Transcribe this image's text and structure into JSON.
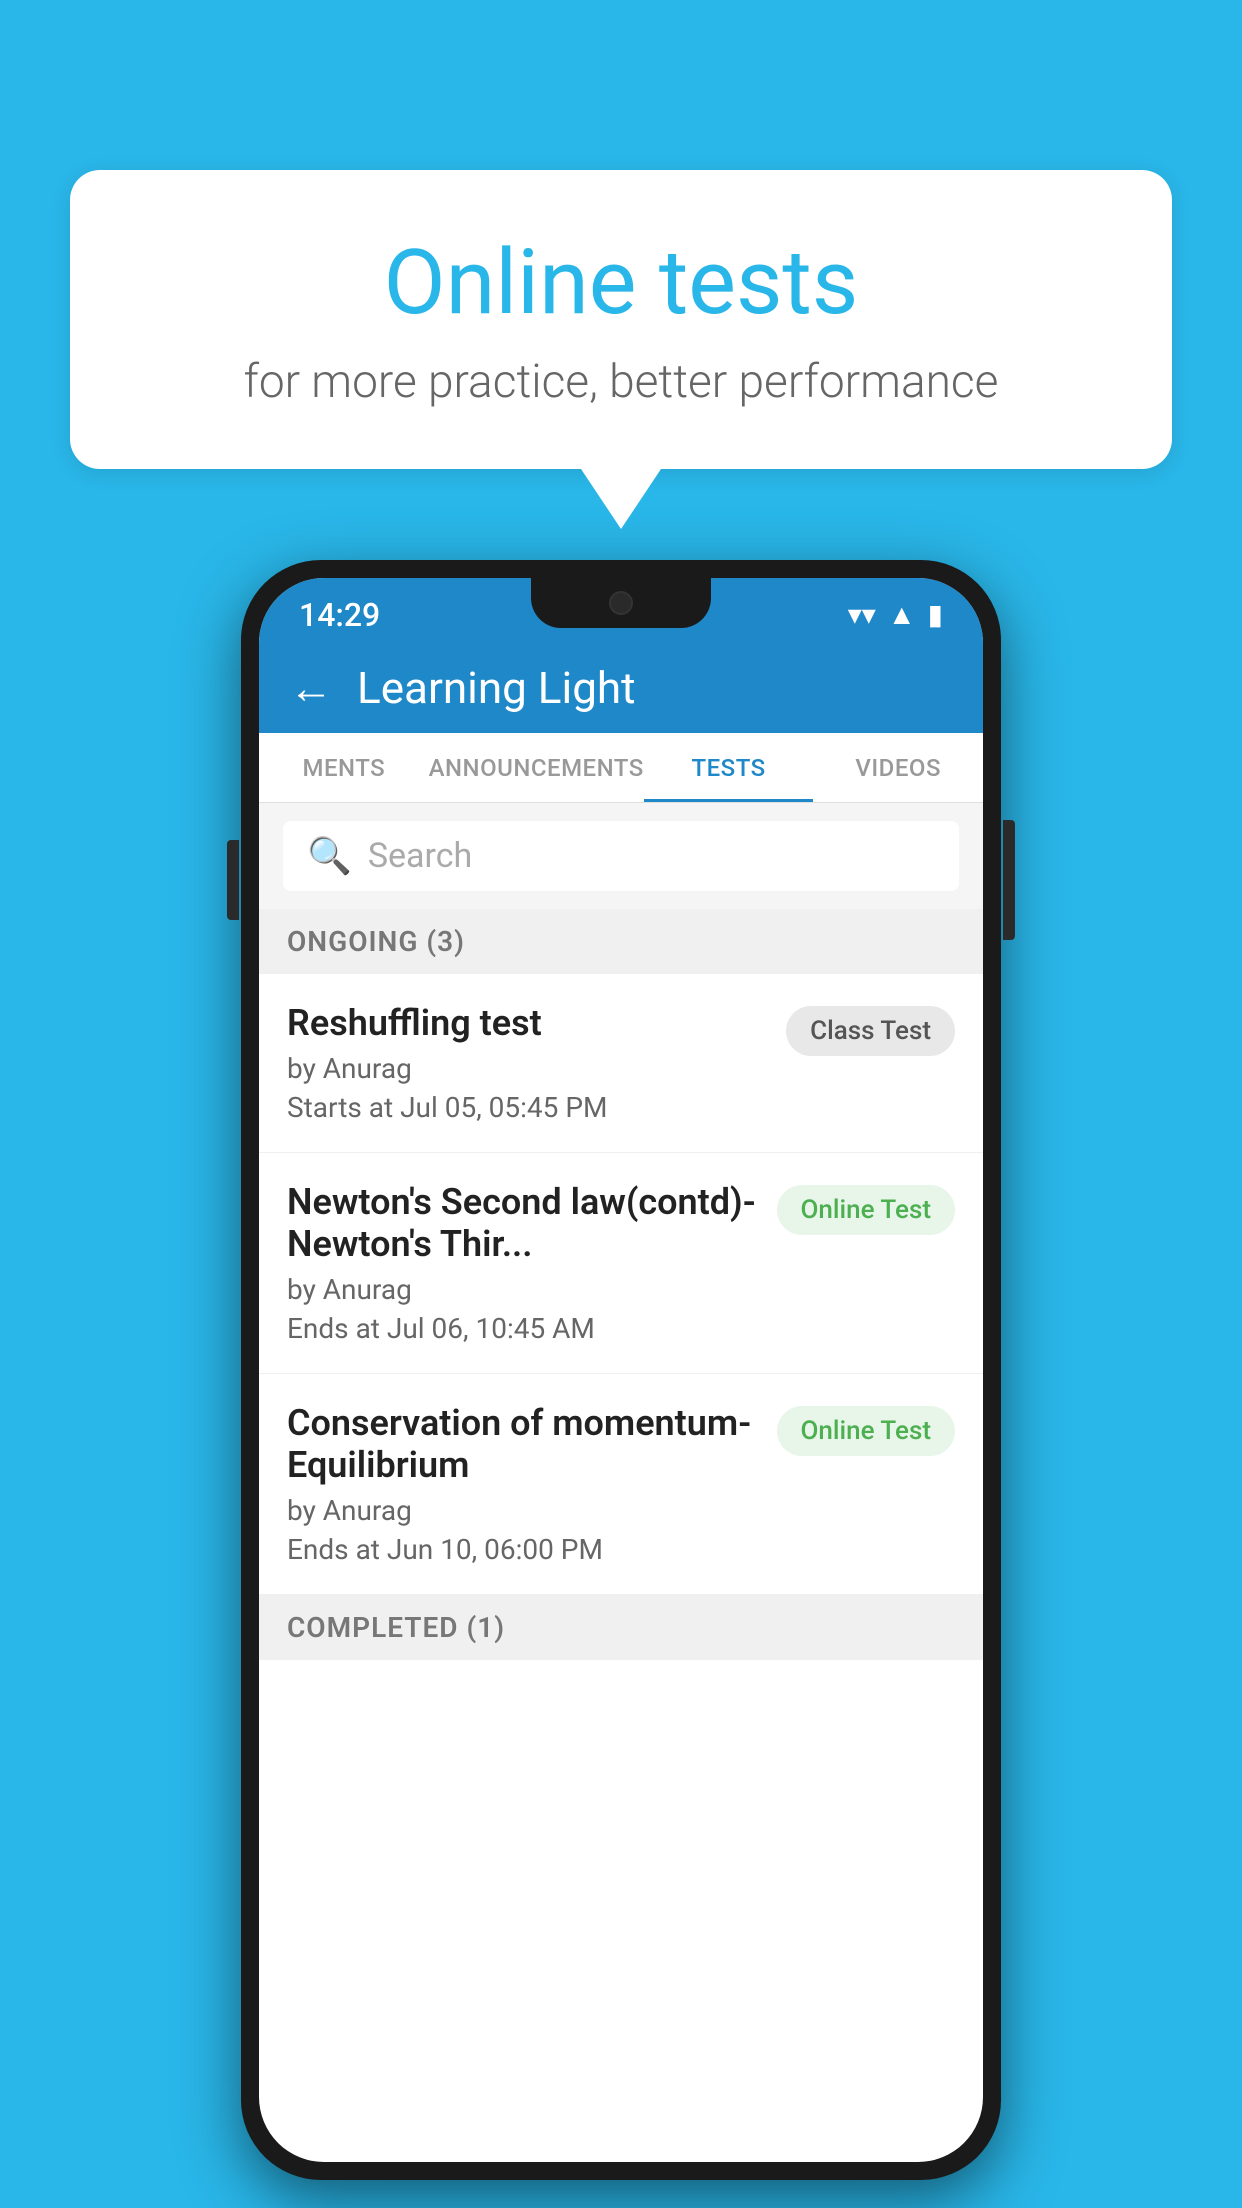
{
  "background": {
    "color": "#29b6e8"
  },
  "speech_bubble": {
    "title": "Online tests",
    "subtitle": "for more practice, better performance"
  },
  "phone": {
    "status_bar": {
      "time": "14:29",
      "wifi": "▼",
      "signal": "▲",
      "battery": "▮"
    },
    "header": {
      "back_label": "←",
      "title": "Learning Light"
    },
    "tabs": [
      {
        "label": "MENTS",
        "active": false
      },
      {
        "label": "ANNOUNCEMENTS",
        "active": false
      },
      {
        "label": "TESTS",
        "active": true
      },
      {
        "label": "VIDEOS",
        "active": false
      }
    ],
    "search": {
      "placeholder": "Search"
    },
    "ongoing_section": {
      "title": "ONGOING (3)"
    },
    "tests": [
      {
        "name": "Reshuffling test",
        "by": "by Anurag",
        "time": "Starts at  Jul 05, 05:45 PM",
        "badge": "Class Test",
        "badge_type": "class"
      },
      {
        "name": "Newton's Second law(contd)-Newton's Thir...",
        "by": "by Anurag",
        "time": "Ends at  Jul 06, 10:45 AM",
        "badge": "Online Test",
        "badge_type": "online"
      },
      {
        "name": "Conservation of momentum-Equilibrium",
        "by": "by Anurag",
        "time": "Ends at  Jun 10, 06:00 PM",
        "badge": "Online Test",
        "badge_type": "online"
      }
    ],
    "completed_section": {
      "title": "COMPLETED (1)"
    }
  }
}
